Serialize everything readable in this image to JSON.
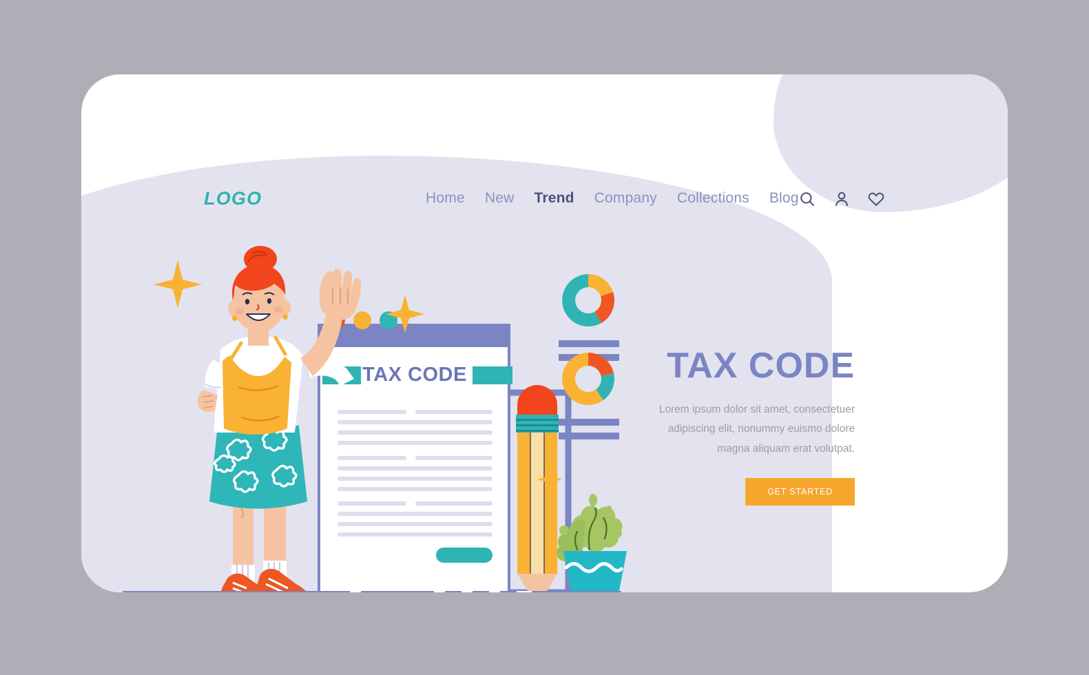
{
  "page": {
    "background_color": "#aeaeb7",
    "card_color": "#ffffff",
    "blob_color": "#e2e3ee"
  },
  "header": {
    "logo": "LOGO",
    "logo_color": "#31b0ae",
    "nav": [
      {
        "label": "Home",
        "active": false
      },
      {
        "label": "New",
        "active": false
      },
      {
        "label": "Trend",
        "active": true
      },
      {
        "label": "Company",
        "active": false
      },
      {
        "label": "Collections",
        "active": false
      },
      {
        "label": "Blog",
        "active": false
      }
    ],
    "icons": [
      {
        "name": "search-icon"
      },
      {
        "name": "user-icon"
      },
      {
        "name": "heart-icon"
      }
    ],
    "nav_color": "#8992bd",
    "nav_active_color": "#4c5277"
  },
  "hero": {
    "title": "TAX CODE",
    "title_color": "#7b85c4",
    "body": "Lorem ipsum dolor sit amet, consectetuer adipiscing elit, nonummy euismo dolore magna aliquam erat volutpat.",
    "body_color": "#9d9da3",
    "cta_label": "GET STARTED",
    "cta_color": "#f6a62c",
    "cta_text_color": "#ffffff"
  },
  "illustration": {
    "document": {
      "title": "TAX CODE",
      "title_color": "#6c76b5",
      "titlebar_color": "#7b85c4",
      "highlight_bar_color": "#2fb3b3",
      "dots": [
        "#f24f23",
        "#f9b233",
        "#2fb6b9"
      ],
      "line_color": "#dcdeee",
      "submit_button_color": "#2fb3b3",
      "line_groups": 3,
      "lines_per_group": 4
    },
    "charts": [
      {
        "name": "donut-chart-top",
        "segments": [
          {
            "color": "#2fb3b3",
            "value": 42
          },
          {
            "color": "#f9b233",
            "value": 20
          },
          {
            "color": "#ee5622",
            "value": 38
          }
        ],
        "bars": 2,
        "bar_color": "#7b85c4"
      },
      {
        "name": "donut-chart-bottom",
        "segments": [
          {
            "color": "#f9b233",
            "value": 48
          },
          {
            "color": "#ee5622",
            "value": 22
          },
          {
            "color": "#2fb3b3",
            "value": 30
          }
        ],
        "bars": 2,
        "bar_color": "#7b85c4"
      }
    ],
    "pencil": {
      "eraser_color": "#f2441d",
      "ferrule_color": "#2fb3b3",
      "body_color": "#f9b233",
      "body_light_color": "#fadfa6",
      "wood_color": "#f6c3a2",
      "lead_color": "#2b2f52"
    },
    "plant": {
      "pot_color": "#22b8c6",
      "leaf_color": "#a5c663",
      "leaf_dark_color": "#9bbf5c"
    },
    "character": {
      "hair_color": "#f2441d",
      "skin_color": "#f6c3a2",
      "top_color": "#f9b233",
      "shirt_color": "#ffffff",
      "skirt_color": "#2fb6b9",
      "shoe_color": "#ee5622"
    },
    "ground": {
      "band_color": "#7b85c4",
      "line_color": "#8992bd"
    },
    "sparkles": [
      {
        "color": "#f9b233",
        "size": "large"
      },
      {
        "color": "#f9b233",
        "size": "medium"
      },
      {
        "color": "#f9b233",
        "size": "small"
      }
    ]
  }
}
